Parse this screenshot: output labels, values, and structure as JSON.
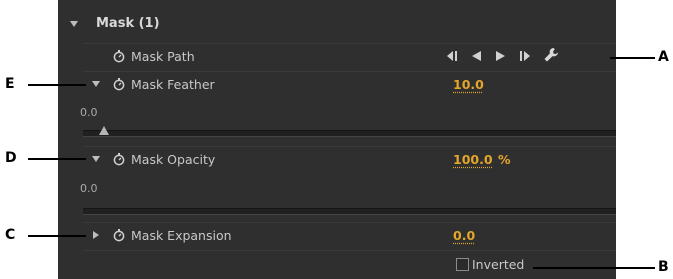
{
  "section": {
    "title": "Mask (1)"
  },
  "mask_path": {
    "label": "Mask Path"
  },
  "mask_feather": {
    "label": "Mask Feather",
    "value": "10.0",
    "slider_min": "0.0",
    "slider_fraction": 0.04
  },
  "mask_opacity": {
    "label": "Mask Opacity",
    "value": "100.0",
    "unit": "%",
    "slider_min": "0.0"
  },
  "mask_expansion": {
    "label": "Mask Expansion",
    "value": "0.0"
  },
  "inverted": {
    "label": "Inverted",
    "checked": false
  },
  "callouts": {
    "a": "A",
    "b": "B",
    "c": "C",
    "d": "D",
    "e": "E"
  },
  "colors": {
    "panel_bg": "#2f2f2f",
    "value_accent": "#e3a62b"
  }
}
